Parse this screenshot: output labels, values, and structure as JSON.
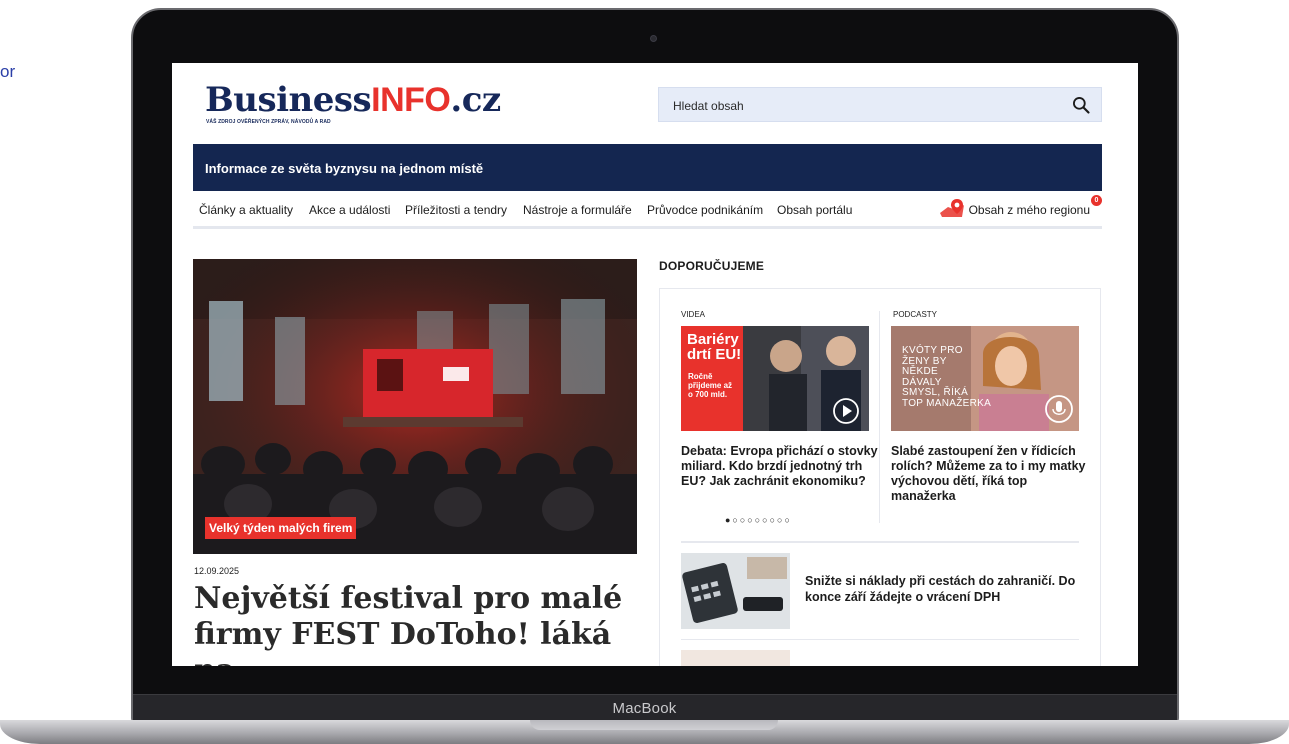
{
  "side_text": "or",
  "device_label": "MacBook",
  "site": {
    "logo_main": "Business",
    "logo_accent": "INFO",
    "logo_tld": ".cz",
    "tagline": "VÁŠ ZDROJ OVĚŘENÝCH ZPRÁV, NÁVODŮ A RAD"
  },
  "search": {
    "placeholder": "Hledat obsah",
    "icon": "search-icon"
  },
  "banner": {
    "text": "Informace ze světa byznysu na jednom místě"
  },
  "nav": {
    "items": [
      "Články a aktuality",
      "Akce a události",
      "Příležitosti a tendry",
      "Nástroje a formuláře",
      "Průvodce podnikáním",
      "Obsah portálu"
    ],
    "region_label": "Obsah z mého regionu",
    "region_badge": "0"
  },
  "hero": {
    "tag": "Velký týden malých firem",
    "date": "12.09.2025",
    "title": "Největší festival pro malé firmy FEST DoToho! láká na"
  },
  "recommend": {
    "heading": "DOPORUČUJEME",
    "videos": {
      "category": "VIDEA",
      "thumb_text": [
        "Bariéry",
        "drtí EU!"
      ],
      "thumb_sub": [
        "Ročně",
        "přijdeme až",
        "o 700 mld."
      ],
      "title": "Debata: Evropa přichází o stovky miliard. Kdo brzdí jednotný trh EU? Jak zachránit ekonomiku?"
    },
    "podcasts": {
      "category": "PODCASTY",
      "thumb_text": [
        "KVÓTY PRO",
        "ŽENY BY",
        "NĚKDE",
        "DÁVALY",
        "SMYSL, ŘÍKÁ",
        "TOP MANAŽERKA"
      ],
      "title": "Slabé zastoupení žen v řídicích rolích? Můžeme za to i my matky výchovou dětí, říká top manažerka"
    },
    "dots": "●○○○○○○○○",
    "article": {
      "title": "Snižte si náklady při cestách do zahraničí. Do konce září žádejte o vrácení DPH"
    }
  },
  "colors": {
    "navy": "#142650",
    "red": "#e8322c",
    "search_bg": "#e6ecf8"
  }
}
